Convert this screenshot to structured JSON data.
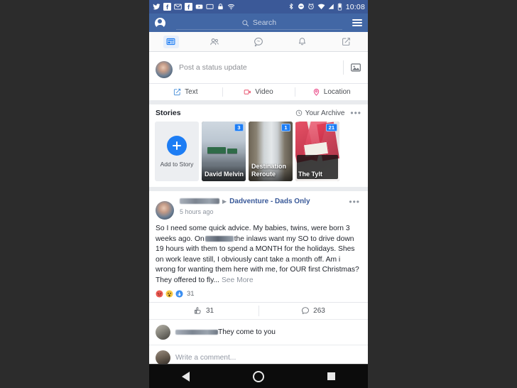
{
  "statusbar": {
    "icons": [
      "twitter-icon",
      "facebook-icon",
      "gmail-icon",
      "facebook-icon",
      "youtube-icon",
      "cast-icon",
      "lock-icon",
      "wifi-icon"
    ],
    "right_icons": [
      "bluetooth-icon",
      "do-not-disturb-icon",
      "alarm-icon",
      "wifi-icon",
      "signal-icon",
      "battery-icon"
    ],
    "clock": "10:08"
  },
  "header": {
    "search_placeholder": "Search",
    "profile_label": "profile",
    "menu_label": "menu"
  },
  "tabs": [
    {
      "name": "news-feed",
      "label": "News Feed",
      "active": true
    },
    {
      "name": "friends",
      "label": "Friend Requests",
      "active": false
    },
    {
      "name": "messenger",
      "label": "Messenger",
      "active": false
    },
    {
      "name": "notifications",
      "label": "Notifications",
      "active": false
    },
    {
      "name": "menu",
      "label": "Menu",
      "active": false
    }
  ],
  "composer": {
    "placeholder": "Post a status update",
    "photo_icon": "photo-icon",
    "quick_actions": [
      {
        "label": "Text",
        "icon": "text-icon",
        "color": "#4a90d9"
      },
      {
        "label": "Video",
        "icon": "video-icon",
        "color": "#e8506b"
      },
      {
        "label": "Location",
        "icon": "location-icon",
        "color": "#e8397d"
      }
    ]
  },
  "stories": {
    "title": "Stories",
    "archive_label": "Your Archive",
    "archive_icon": "clock-icon",
    "more_icon": "overflow-dots-icon",
    "add_story_label": "Add to Story",
    "items": [
      {
        "name": "David Melvin",
        "badge": "3",
        "art": "road"
      },
      {
        "name": "Destination Reroute",
        "badge": "1",
        "art": "water"
      },
      {
        "name": "The Tylt",
        "badge": "21",
        "art": "tylt"
      }
    ]
  },
  "post": {
    "author_redacted": true,
    "group_name": "Dadventure - Dads Only",
    "timestamp": "5 hours ago",
    "more_icon": "overflow-dots-icon",
    "body_part_1": "So I need some quick advice. My babies, twins, were born 3 weeks ago. On",
    "body_part_2": "the inlaws want my SO to drive down 19 hours with them to spend a MONTH for the holidays. Shes on work leave still, I obviously cant take a month off. Am i wrong for wanting them here with me, for OUR first Christmas? They offered to fly...",
    "see_more": "See More",
    "reaction_count": "31",
    "reactions": [
      "angry-reaction",
      "wow-reaction",
      "like-reaction"
    ],
    "like_label": "31",
    "comment_label": "263",
    "like_icon": "thumbs-up-icon",
    "comment_icon": "comment-bubble-icon"
  },
  "comment": {
    "text": "They come to you",
    "placeholder": "Write a comment..."
  },
  "navbar": {
    "back_label": "Back",
    "home_label": "Home",
    "recents_label": "Recents"
  },
  "colors": {
    "status_bar": "#3b5998",
    "header": "#4267a5",
    "accent_blue": "#1d7df4",
    "link_blue": "#385898",
    "page_bg": "#e9ebee"
  }
}
